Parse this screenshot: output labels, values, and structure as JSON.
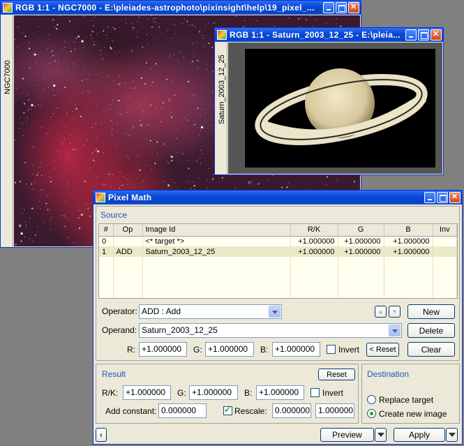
{
  "ngc_window": {
    "title": "RGB 1:1 - NGC7000 - E:\\pleiades-astrophoto\\pixinsight\\help\\19_pixel_...",
    "side_label": "NGC7000"
  },
  "saturn_window": {
    "title": "RGB 1:1 - Saturn_2003_12_25 - E:\\pleia...",
    "side_label": "Saturn_2003_12_25"
  },
  "pixel_math": {
    "title": "Pixel Math",
    "source": {
      "section_label": "Source",
      "columns": [
        "#",
        "Op",
        "Image Id",
        "R/K",
        "G",
        "B",
        "Inv"
      ],
      "rows": [
        {
          "idx": "0",
          "op": "",
          "image_id": "<* target *>",
          "rk": "+1.000000",
          "g": "+1.000000",
          "b": "+1.000000",
          "inv": ""
        },
        {
          "idx": "1",
          "op": "ADD",
          "image_id": "Saturn_2003_12_25",
          "rk": "+1.000000",
          "g": "+1.000000",
          "b": "+1.000000",
          "inv": ""
        }
      ],
      "operator_label": "Operator:",
      "operator_value": "ADD : Add",
      "operand_label": "Operand:",
      "operand_value": "Saturn_2003_12_25",
      "r_label": "R:",
      "r_value": "+1.000000",
      "g_label": "G:",
      "g_value": "+1.000000",
      "b_label": "B:",
      "b_value": "+1.000000",
      "invert_label": "Invert",
      "reset_label": "< Reset",
      "new_label": "New",
      "delete_label": "Delete",
      "clear_label": "Clear"
    },
    "result": {
      "section_label": "Result",
      "reset_label": "Reset",
      "rk_label": "R/K:",
      "rk_value": "+1.000000",
      "g_label": "G:",
      "g_value": "+1.000000",
      "b_label": "B:",
      "b_value": "+1.000000",
      "invert_label": "Invert",
      "add_constant_label": "Add constant:",
      "add_constant_value": "0.000000",
      "rescale_label": "Rescale:",
      "rescale_min": "0.000000",
      "rescale_max": "1.000000"
    },
    "destination": {
      "section_label": "Destination",
      "replace_label": "Replace target",
      "create_label": "Create new image"
    },
    "preview_label": "Preview",
    "apply_label": "Apply"
  }
}
